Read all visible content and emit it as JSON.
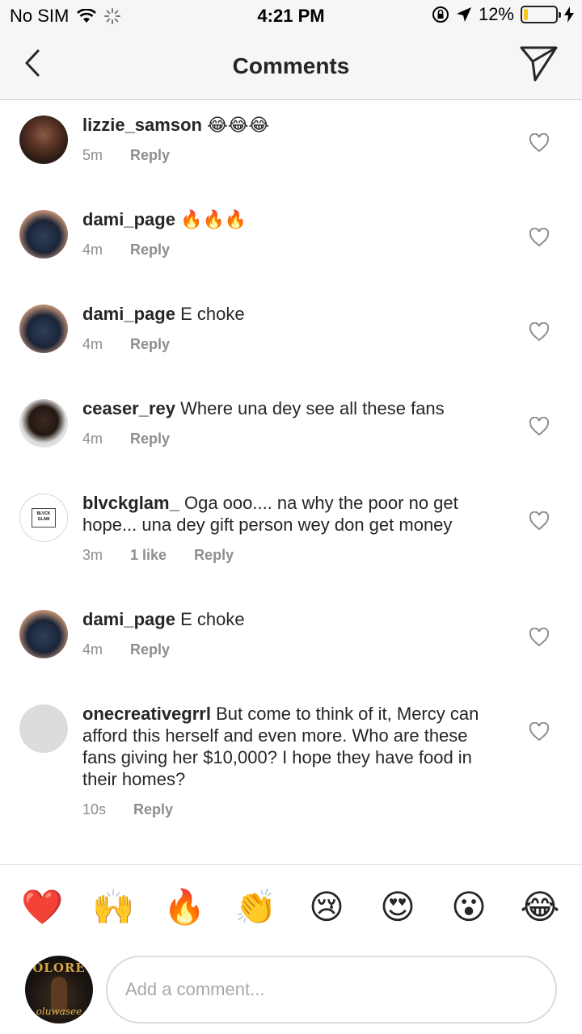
{
  "status_bar": {
    "carrier": "No SIM",
    "time": "4:21 PM",
    "battery_percent": "12%",
    "battery_level": 0.12,
    "battery_color": "#f7c61b"
  },
  "header": {
    "title": "Comments",
    "back_icon": "chevron-left-icon",
    "send_icon": "paper-plane-icon"
  },
  "comments": [
    {
      "username": "lizzie_samson",
      "text": "😂😂😂",
      "time": "5m",
      "likes": "",
      "reply_label": "Reply"
    },
    {
      "username": "dami_page",
      "text": "🔥🔥🔥",
      "time": "4m",
      "likes": "",
      "reply_label": "Reply"
    },
    {
      "username": "dami_page",
      "text": "E choke",
      "time": "4m",
      "likes": "",
      "reply_label": "Reply"
    },
    {
      "username": "ceaser_rey",
      "text": "Where una dey see all these fans",
      "time": "4m",
      "likes": "",
      "reply_label": "Reply"
    },
    {
      "username": "blvckglam_",
      "text": "Oga ooo.... na why the poor no get hope... una dey gift person wey don get money",
      "time": "3m",
      "likes": "1 like",
      "reply_label": "Reply",
      "avatar_text": "BLVCK GLAM"
    },
    {
      "username": "dami_page",
      "text": "E choke",
      "time": "4m",
      "likes": "",
      "reply_label": "Reply"
    },
    {
      "username": "onecreativegrrl",
      "text": "But come to think of it, Mercy can afford this herself and even more. Who are these fans giving her $10,000? I hope they have food in their homes?",
      "time": "10s",
      "likes": "",
      "reply_label": "Reply"
    }
  ],
  "emoji_bar": [
    "❤️",
    "🙌",
    "🔥",
    "👏",
    "😢",
    "😍",
    "😮",
    "😂"
  ],
  "composer": {
    "placeholder": "Add a comment...",
    "avatar_brand": "OLORE",
    "avatar_script": "oluwasee"
  }
}
